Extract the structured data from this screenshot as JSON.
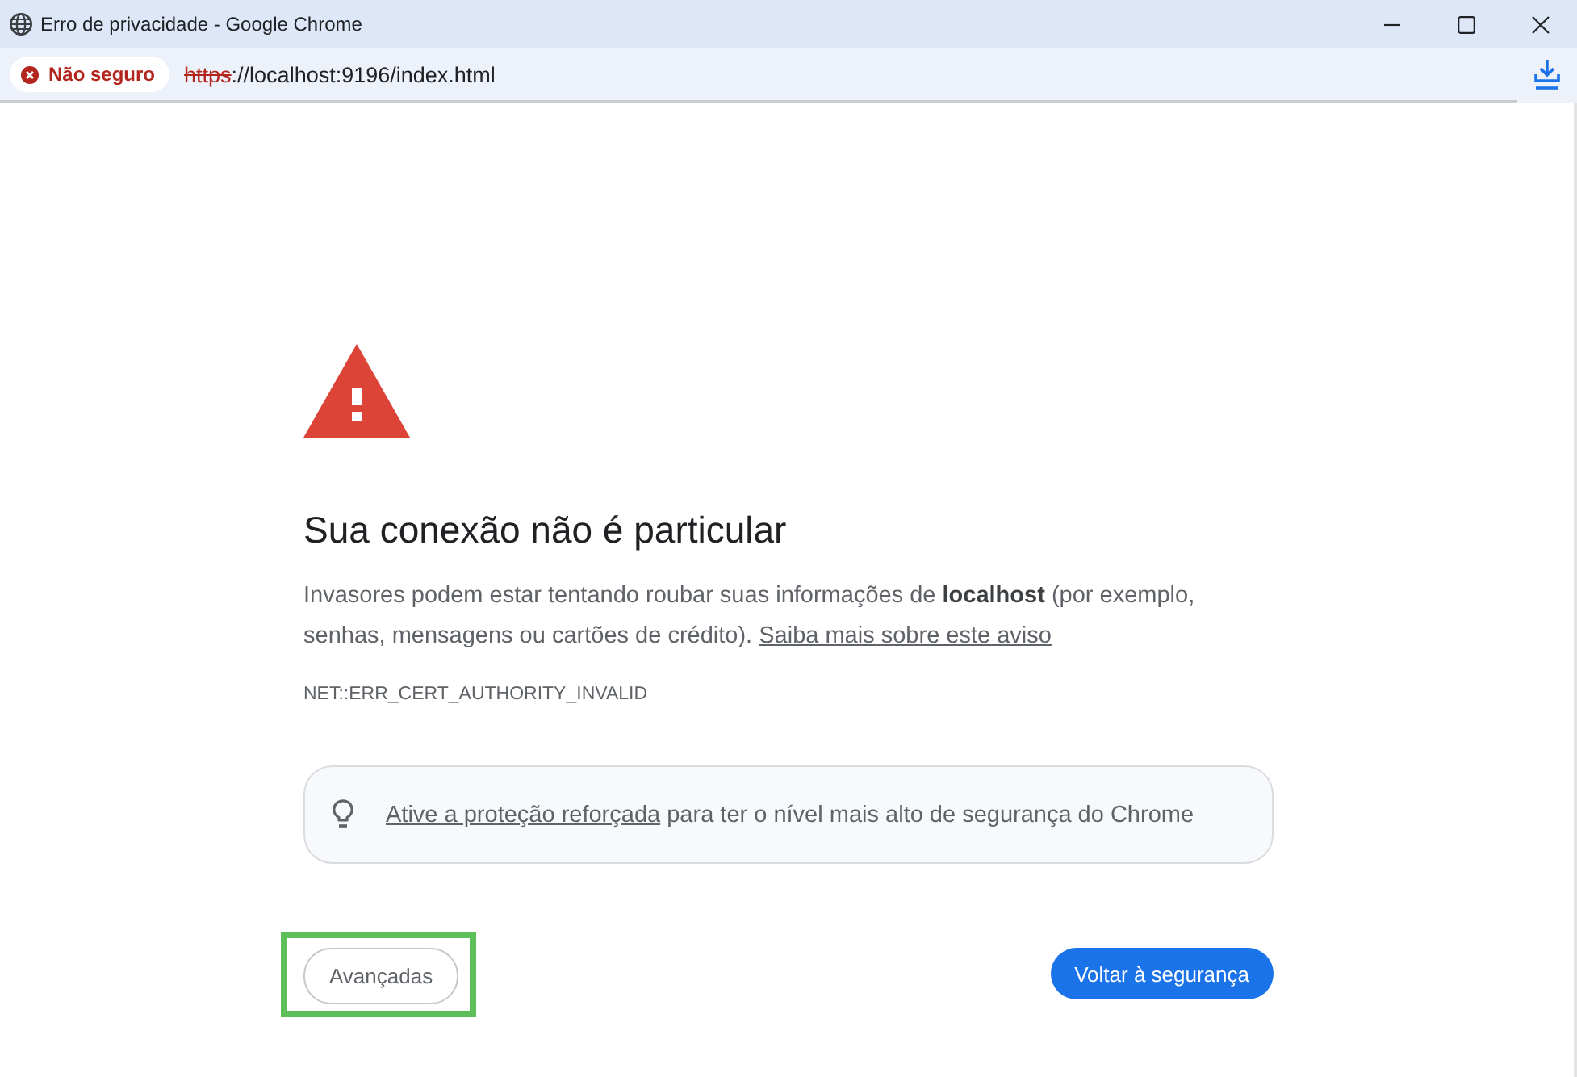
{
  "window": {
    "title": "Erro de privacidade - Google Chrome"
  },
  "address_bar": {
    "security_chip": "Não seguro",
    "url": {
      "scheme": "https",
      "scheme_struck": true,
      "rest": "://localhost:9196/index.html"
    }
  },
  "page": {
    "heading": "Sua conexão não é particular",
    "message": "Invasores podem estar tentando roubar suas informações de **localhost** (por exemplo, senhas, mensagens ou cartões de crédito).",
    "learn_more_link": "Saiba mais sobre este aviso",
    "error_code": "NET::ERR_CERT_AUTHORITY_INVALID",
    "tip": {
      "link": "Ative a proteção reforçada",
      "text": "para ter o nível mais alto de segurança do Chrome"
    },
    "buttons": [
      {
        "kind": "secondary",
        "label": "Avançadas",
        "highlighted": true
      },
      {
        "kind": "primary",
        "label": "Voltar à segurança",
        "highlighted": false
      }
    ]
  }
}
